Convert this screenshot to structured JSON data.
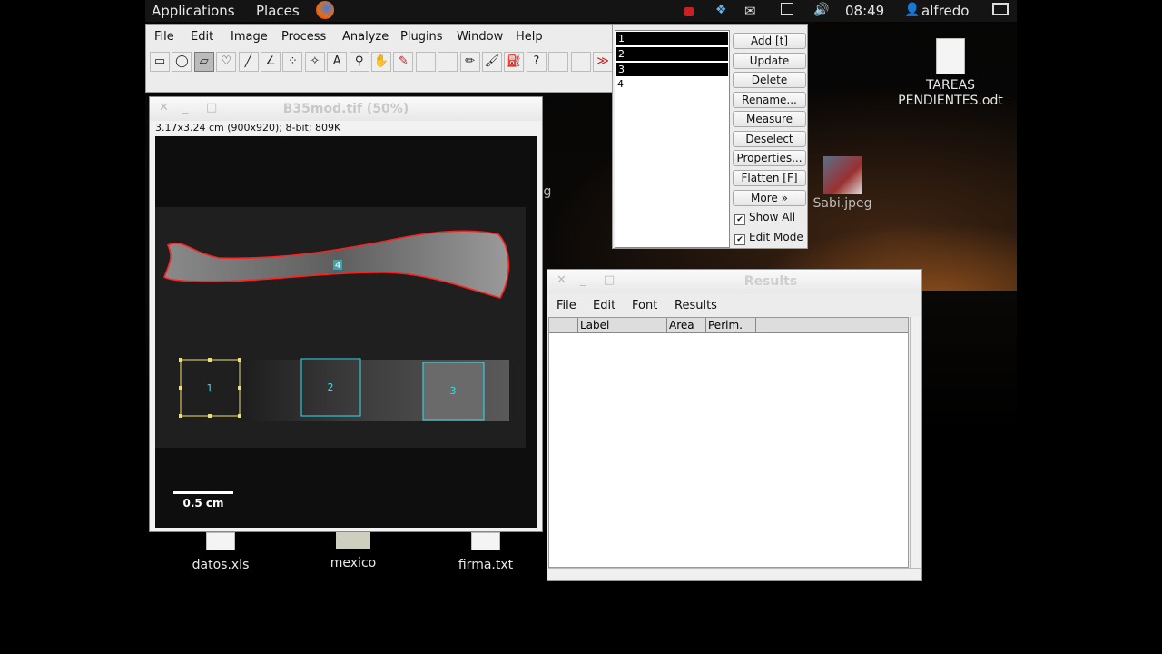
{
  "panel": {
    "applications": "Applications",
    "places": "Places",
    "clock": "08:49",
    "user": "alfredo"
  },
  "imagej": {
    "menu": [
      "File",
      "Edit",
      "Image",
      "Process",
      "Analyze",
      "Plugins",
      "Window",
      "Help"
    ],
    "tools": [
      "rectangle-icon",
      "oval-icon",
      "polygon-icon",
      "freehand-icon",
      "line-icon",
      "angle-icon",
      "point-icon",
      "wand-icon",
      "text-icon",
      "magnifier-icon",
      "hand-icon",
      "dropper-icon",
      "",
      "",
      "pencil-icon",
      "brush-icon",
      "flood-fill-icon",
      "help-icon",
      "",
      "",
      "more-tools-icon"
    ],
    "selected_tool": 2
  },
  "image_window": {
    "title": "B35mod.tif (50%)",
    "info": "3.17x3.24 cm (900x920); 8-bit; 809K",
    "rois": [
      {
        "label": "4"
      },
      {
        "label": "1"
      },
      {
        "label": "2"
      },
      {
        "label": "3"
      }
    ],
    "scale_bar": "0.5 cm",
    "colors": {
      "bone_outline": "#ff2020",
      "active_roi": "#f0e070",
      "roi": "#30e0f0"
    }
  },
  "roi_manager": {
    "items": [
      "1",
      "2",
      "3",
      "4"
    ],
    "selected": [
      0,
      1,
      2
    ],
    "buttons": [
      "Add [t]",
      "Update",
      "Delete",
      "Rename...",
      "Measure",
      "Deselect",
      "Properties...",
      "Flatten [F]",
      "More »"
    ],
    "show_all": {
      "label": "Show All",
      "checked": true
    },
    "edit_mode": {
      "label": "Edit Mode",
      "checked": true
    }
  },
  "results": {
    "title": "Results",
    "menu": [
      "File",
      "Edit",
      "Font",
      "Results"
    ],
    "columns": [
      "",
      "Label",
      "Area",
      "Perim."
    ]
  },
  "desktop": {
    "icons": [
      {
        "name": "TAREAS\nPENDIENTES.odt"
      },
      {
        "name": "Sabi.jpeg"
      },
      {
        "name": "datos.xls"
      },
      {
        "name": "mexico"
      },
      {
        "name": "firma.txt"
      }
    ],
    "partial_label": "g"
  }
}
